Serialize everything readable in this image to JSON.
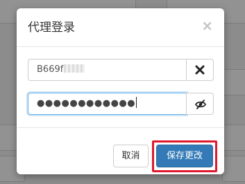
{
  "modal": {
    "title": "代理登录",
    "close_symbol": "×"
  },
  "form": {
    "username": {
      "visible_value": "B669f",
      "masked": true,
      "clear_icon": "times-icon"
    },
    "password": {
      "masked_value": "●●●●●●●●●●●●",
      "focused": true,
      "toggle_icon": "eye-slash-icon"
    }
  },
  "footer": {
    "cancel_label": "取消",
    "save_label": "保存更改"
  },
  "colors": {
    "primary": "#337ab7",
    "highlight": "#e0182d",
    "focus": "#66afe9"
  }
}
